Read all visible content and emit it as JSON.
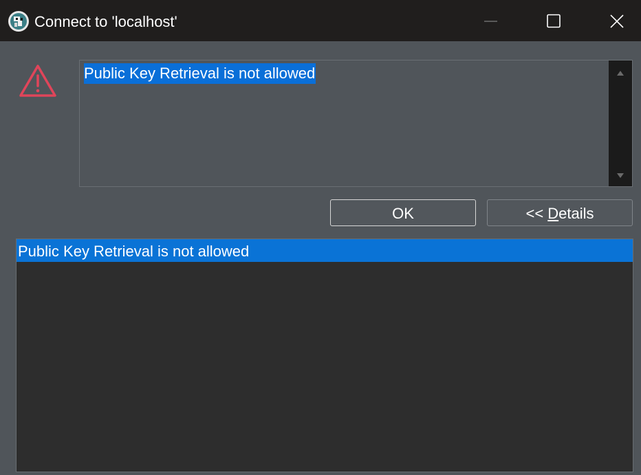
{
  "window": {
    "title": "Connect to 'localhost'",
    "icon": "dbeaver-beaver-icon"
  },
  "window_controls": {
    "minimize_icon": "minimize-icon",
    "maximize_icon": "maximize-icon",
    "close_icon": "close-icon"
  },
  "dialog": {
    "severity_icon": "warning-triangle-icon",
    "severity_color": "#e0455a",
    "message": "Public Key Retrieval is not allowed",
    "buttons": {
      "ok_label": "OK",
      "details_prefix": "<< ",
      "details_accel": "D",
      "details_rest": "etails"
    },
    "details": {
      "items": [
        {
          "label": "Public Key Retrieval is not allowed",
          "selected": true
        }
      ]
    }
  },
  "colors": {
    "titlebar": "#201e1d",
    "dialog_bg": "#50555a",
    "selection": "#0a73d6",
    "list_bg": "#2d2d2d"
  }
}
